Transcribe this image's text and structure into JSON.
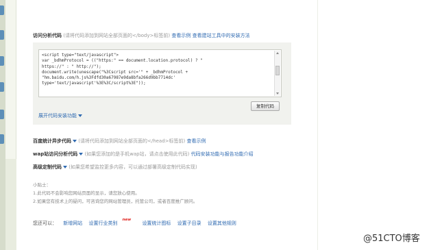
{
  "analytics_code": {
    "title": "访问分析代码",
    "hint": "(请将代码添加到网站全部页面的</body>标签前)",
    "link_example": "查看示例",
    "link_install": "查看建站工具中的安装方法",
    "code_lines": [
      "<script type=\"text/javascript\">",
      "var _bdhmProtocol = ((\"https:\" == document.location.protocol) ? \"",
      "https://\" : \" http://\");",
      "document.write(unescape(\"%3Cscript src='\" + _bdhmProtocol +",
      "\"hm.baidu.com/h.js%3Fdfd30a67987e9da8bfa266d9bb7714dc'",
      "type='text/javascript'%3E%3C/script%3E\"));"
    ],
    "copy_button": "复制代码",
    "expand_link": "展开代码安装功能"
  },
  "sync_code": {
    "title": "百度统计异步代码",
    "hint": "(请将代码添加到网站全部页面的</head>标签前)",
    "link_example": "查看示例"
  },
  "wap_code": {
    "title": "wap站访问分析代码",
    "hint": "(如果您添加的是手机wap站，请点击使用此代码)",
    "link": "代码安装功能与报告功能介绍"
  },
  "custom_code": {
    "title": "高级定制代码",
    "hint": "(如果您希望监控更多内容，可以通过部署高级定制代码实现)"
  },
  "tips": {
    "heading": "小贴士：",
    "lines": [
      "1.此代码不会影响您网站页面的显示，请您放心使用。",
      "2.如果您有技术上的疑问，可咨询您的网站管理员，托管公司，或者百度推广顾问。"
    ]
  },
  "nav": {
    "label": "您还可以：",
    "items": [
      "新增网站",
      "设置行业类别",
      "设置统计图标",
      "设置子目录",
      "设置其他规则"
    ],
    "new_badge": "new"
  },
  "watermark": "@51CTO博客"
}
